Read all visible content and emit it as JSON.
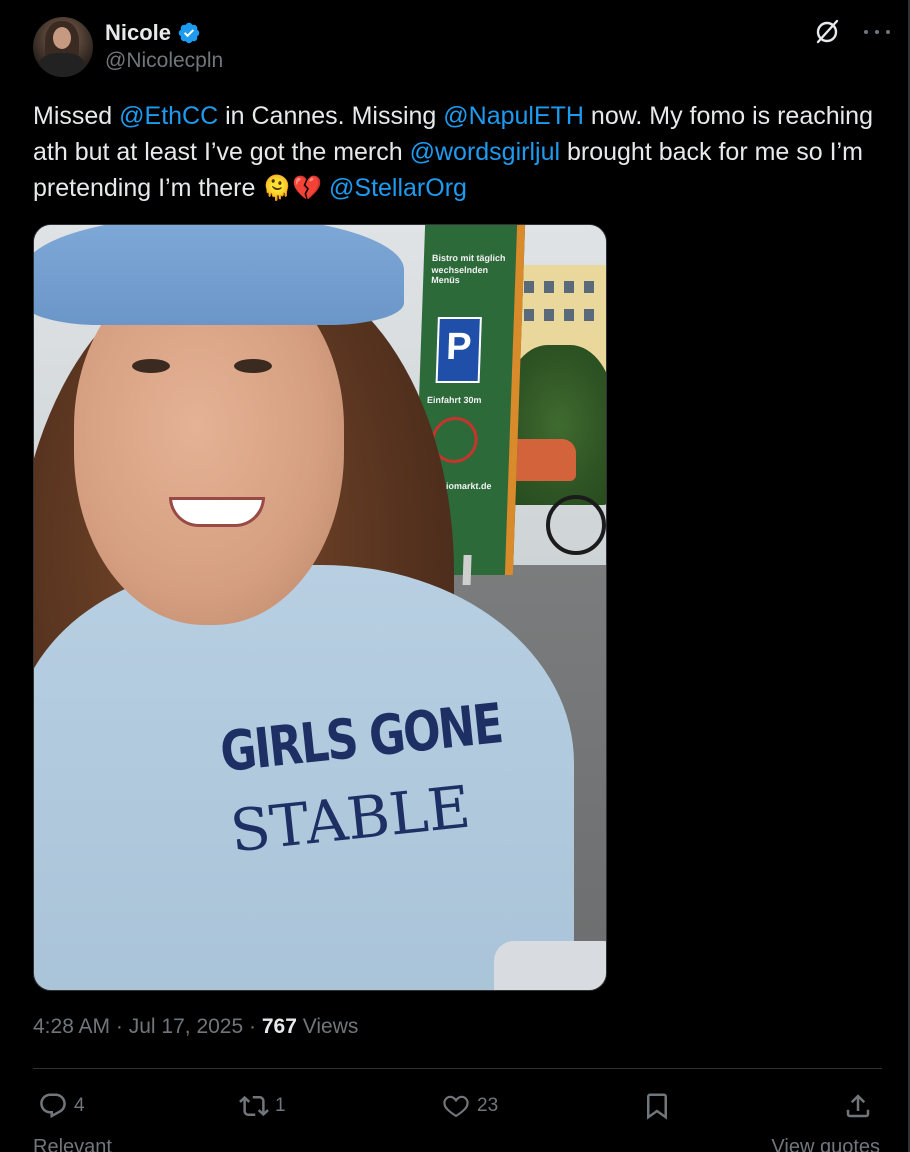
{
  "author": {
    "display_name": "Nicole",
    "handle": "@Nicolecpln",
    "verified": true,
    "verified_color": "#1d9bf0"
  },
  "tweet": {
    "segments": [
      {
        "type": "text",
        "value": "Missed "
      },
      {
        "type": "mention",
        "value": "@EthCC"
      },
      {
        "type": "text",
        "value": " in Cannes. Missing "
      },
      {
        "type": "mention",
        "value": "@NapulETH"
      },
      {
        "type": "text",
        "value": " now. My fomo is reaching ath but at least I’ve got the merch  "
      },
      {
        "type": "mention",
        "value": "@wordsgirljul"
      },
      {
        "type": "text",
        "value": " brought back for me so I’m pretending I’m there "
      },
      {
        "type": "emoji",
        "value": "🫠💔"
      },
      {
        "type": "text",
        "value": " "
      },
      {
        "type": "mention",
        "value": "@StellarOrg"
      }
    ]
  },
  "media": {
    "shirt_print_line1": "GIRLS GONE",
    "shirt_print_line2": "STABLE",
    "sign_text_1": "Bistro mit täglich",
    "sign_text_2": "wechselnden Menüs",
    "sign_text_3": "Einfahrt 30m",
    "sign_text_4": "bio-biomarkt.de",
    "parking_letter": "P"
  },
  "meta": {
    "time": "4:28 AM",
    "separator": " · ",
    "date": "Jul 17, 2025",
    "views_count": "767",
    "views_label": " Views"
  },
  "actions": {
    "replies": "4",
    "reposts": "1",
    "likes": "23"
  },
  "footer": {
    "left": "Relevant",
    "right": "View quotes"
  },
  "colors": {
    "background": "#000000",
    "text": "#e7e9ea",
    "muted": "#71767b",
    "accent": "#1d9bf0",
    "border": "#2f3336"
  },
  "icons": [
    "verified-badge-icon",
    "grok-icon",
    "more-icon",
    "reply-icon",
    "repost-icon",
    "like-icon",
    "bookmark-icon",
    "share-icon"
  ]
}
